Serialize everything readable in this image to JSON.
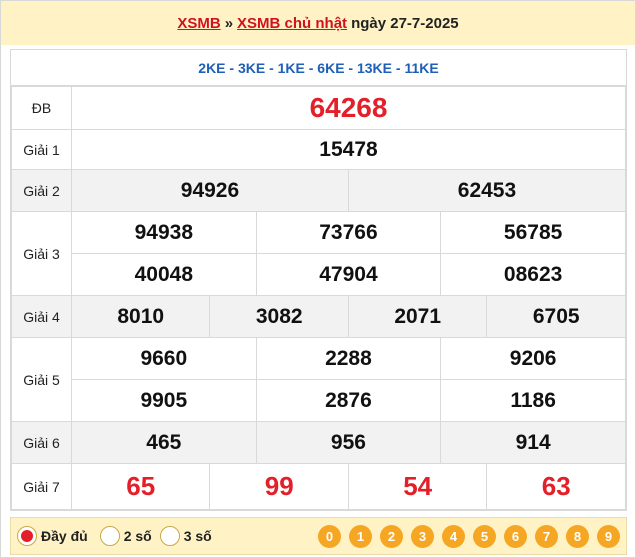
{
  "header": {
    "link1": "XSMB",
    "sep": "»",
    "link2": "XSMB chủ nhật",
    "date": "ngày 27-7-2025"
  },
  "codes": "2KE - 3KE - 1KE - 6KE - 13KE - 11KE",
  "prizes": {
    "db": {
      "label": "ĐB",
      "value": "64268"
    },
    "g1": {
      "label": "Giải 1",
      "values": [
        "15478"
      ]
    },
    "g2": {
      "label": "Giải 2",
      "values": [
        "94926",
        "62453"
      ]
    },
    "g3": {
      "label": "Giải 3",
      "values": [
        "94938",
        "73766",
        "56785",
        "40048",
        "47904",
        "08623"
      ]
    },
    "g4": {
      "label": "Giải 4",
      "values": [
        "8010",
        "3082",
        "2071",
        "6705"
      ]
    },
    "g5": {
      "label": "Giải 5",
      "values": [
        "9660",
        "2288",
        "9206",
        "9905",
        "2876",
        "1186"
      ]
    },
    "g6": {
      "label": "Giải 6",
      "values": [
        "465",
        "956",
        "914"
      ]
    },
    "g7": {
      "label": "Giải 7",
      "values": [
        "65",
        "99",
        "54",
        "63"
      ]
    }
  },
  "footer": {
    "options": [
      "Đầy đủ",
      "2 số",
      "3 số"
    ],
    "selected": "Đầy đủ",
    "digits": [
      "0",
      "1",
      "2",
      "3",
      "4",
      "5",
      "6",
      "7",
      "8",
      "9"
    ]
  },
  "colors": {
    "red": "#e3202a",
    "blue": "#1f5fb8",
    "header_bg": "#fff3c6",
    "digit_bg": "#f5a623"
  }
}
